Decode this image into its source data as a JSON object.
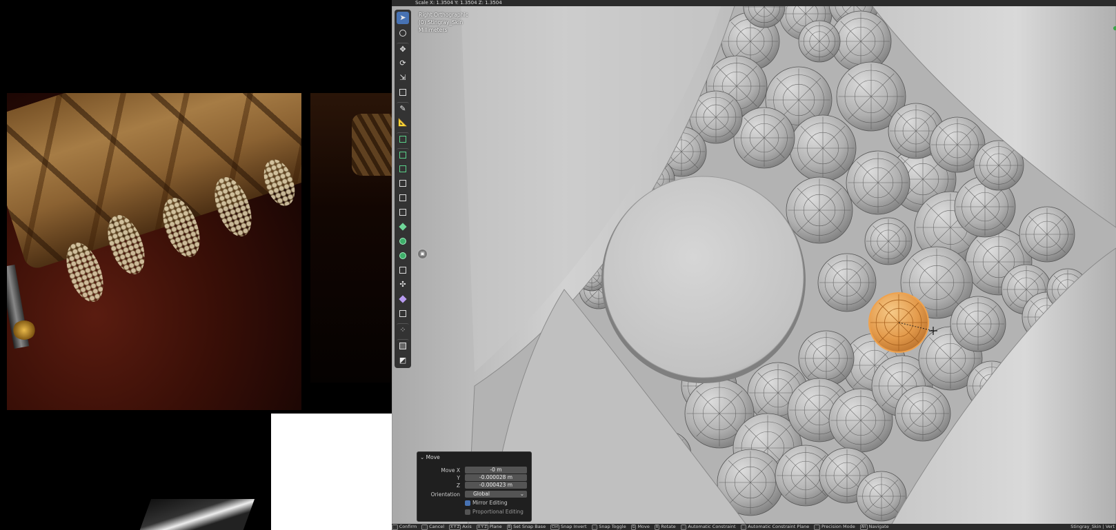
{
  "header": {
    "transform_readout": "Scale X: 1.3504   Y: 1.3504   Z: 1.3504"
  },
  "view_info": {
    "view_name": "Right Orthographic",
    "object_name": "(0) Stingray_Skin",
    "units": "Millimeters"
  },
  "toolbar": {
    "tools": [
      "select-box",
      "cursor",
      "move",
      "rotate",
      "scale",
      "transform",
      "annotate",
      "measure",
      "add-cube",
      "extrude-region",
      "inset-faces",
      "bevel",
      "loop-cut",
      "knife",
      "poly-build",
      "spin",
      "smooth",
      "edge-slide",
      "shrink-fatten",
      "shear",
      "rip-region",
      "to-sphere",
      "randomize"
    ],
    "active_tool": "select-box"
  },
  "move_panel": {
    "title": "Move",
    "move_x_label": "Move X",
    "move_x_value": "-0 m",
    "y_label": "Y",
    "y_value": "-0.000028 m",
    "z_label": "Z",
    "z_value": "-0.000423 m",
    "orientation_label": "Orientation",
    "orientation_value": "Global",
    "mirror_label": "Mirror Editing",
    "mirror_checked": true,
    "proportional_label": "Proportional Editing",
    "proportional_checked": false
  },
  "status_bar": {
    "items": [
      {
        "key": "",
        "label": "Confirm"
      },
      {
        "key": "",
        "label": "Cancel"
      },
      {
        "key": "X Y Z",
        "label": "Axis"
      },
      {
        "key": "X Y Z",
        "label": "Plane"
      },
      {
        "key": "B",
        "label": "Set Snap Base"
      },
      {
        "key": "Ctrl",
        "label": "Snap Invert"
      },
      {
        "key": "",
        "label": "Snap Toggle"
      },
      {
        "key": "G",
        "label": "Move"
      },
      {
        "key": "R",
        "label": "Rotate"
      },
      {
        "key": "",
        "label": "Automatic Constraint"
      },
      {
        "key": "",
        "label": "Automatic Constraint Plane"
      },
      {
        "key": "",
        "label": "Precision Mode"
      },
      {
        "key": "Alt",
        "label": "Navigate"
      }
    ],
    "right_text": "Stingray_Skin | Vert"
  },
  "colors": {
    "selection_orange": "#e8963a",
    "active_tool_blue": "#4772b3",
    "viewport_gray": "#b6b6b6"
  }
}
